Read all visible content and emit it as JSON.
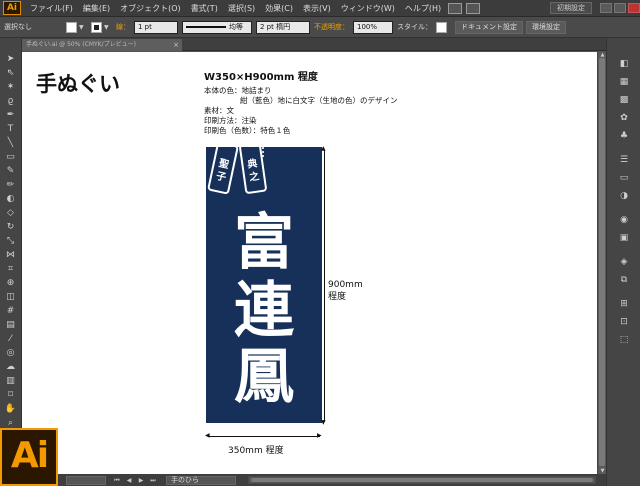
{
  "app": {
    "logo_small": "Ai",
    "logo_big": "Ai",
    "brand_color": "#f29a00"
  },
  "menu": {
    "items": [
      "ファイル(F)",
      "編集(E)",
      "オブジェクト(O)",
      "書式(T)",
      "選択(S)",
      "効果(C)",
      "表示(V)",
      "ウィンドウ(W)",
      "ヘルプ(H)"
    ],
    "workspace_label": "初期設定"
  },
  "control": {
    "selection_label": "選択なし",
    "stroke_label": "線：",
    "stroke_weight": "1 pt",
    "stroke_profile": "均等",
    "brush": "2 pt 楕円",
    "opacity_label": "不透明度：",
    "opacity_value": "100%",
    "style_label": "スタイル：",
    "doc_setup_button": "ドキュメント設定",
    "prefs_button": "環境設定"
  },
  "document": {
    "tab_title": "手ぬぐい.ai @ 50% (CMYK/プレビュー)"
  },
  "artwork": {
    "title": "手ぬぐい",
    "headline": "W350×H900mm 程度",
    "spec_lines": [
      "本体の色：地詰まり",
      "紺（藍色）地に白文字（生地の色）のデザイン",
      "素材：文",
      "印刷方法：注染",
      "印刷色（色数）：特色１色"
    ],
    "tags": [
      "聖子",
      "典之"
    ],
    "big_text": [
      "富",
      "連",
      "鳳"
    ],
    "towel_color": "#17305a",
    "height_label_1": "900mm",
    "height_label_2": "程度",
    "width_label": "350mm 程度"
  },
  "status": {
    "tool_name": "手のひら"
  }
}
